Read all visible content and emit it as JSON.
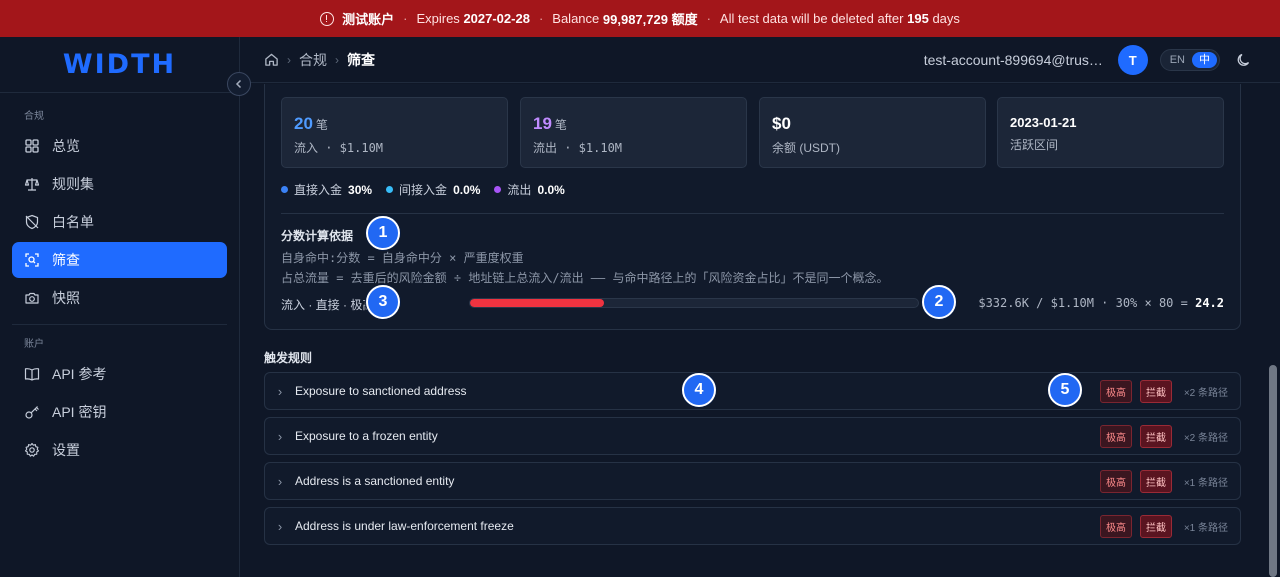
{
  "banner": {
    "account": "测试账户",
    "expires_label": "Expires",
    "expires_value": "2027-02-28",
    "balance_label": "Balance",
    "balance_value": "99,987,729 额度",
    "notice_prefix": "All test data will be deleted after",
    "notice_days": "195",
    "notice_suffix": "days"
  },
  "sidebar": {
    "logo": "WIDTH",
    "section_compliance": "合规",
    "items_compliance": [
      {
        "label": "总览",
        "icon": "grid-icon"
      },
      {
        "label": "规则集",
        "icon": "scale-icon"
      },
      {
        "label": "白名单",
        "icon": "shield-off-icon"
      },
      {
        "label": "筛查",
        "icon": "scan-icon",
        "active": true
      },
      {
        "label": "快照",
        "icon": "camera-icon"
      }
    ],
    "section_account": "账户",
    "items_account": [
      {
        "label": "API 参考",
        "icon": "book-icon"
      },
      {
        "label": "API 密钥",
        "icon": "key-icon"
      },
      {
        "label": "设置",
        "icon": "settings-icon"
      }
    ]
  },
  "header": {
    "breadcrumb": [
      "合规",
      "筛查"
    ],
    "email": "test-account-899694@trustin.info",
    "avatar_initial": "T",
    "lang_en": "EN",
    "lang_zh": "中"
  },
  "stats": [
    {
      "value": "20",
      "unit": "笔",
      "sub": "流入 · $1.10M",
      "color": "#4f9bff"
    },
    {
      "value": "19",
      "unit": "笔",
      "sub": "流出 · $1.10M",
      "color": "#c08bff"
    },
    {
      "value": "$0",
      "unit": "",
      "sub": "余额 (USDT)",
      "color": "#ffffff"
    },
    {
      "value": "2023-01-21",
      "unit": "",
      "sub": "活跃区间",
      "color": "#ffffff"
    }
  ],
  "legend": [
    {
      "label": "直接入金",
      "value": "30%",
      "color": "#3b82f6"
    },
    {
      "label": "间接入金",
      "value": "0.0%",
      "color": "#38bdf8"
    },
    {
      "label": "流出",
      "value": "0.0%",
      "color": "#a855f7"
    }
  ],
  "basis": {
    "title": "分数计算依据",
    "formula1": "自身命中:分数 = 自身命中分 × 严重度权重",
    "formula2": "占总流量 = 去重后的风险金额 ÷ 地址链上总流入/流出 —— 与命中路径上的「风险资金占比」不是同一个概念。",
    "row_label": "流入 · 直接 · 极高",
    "bar_fraction": 0.3,
    "calc_prefix": "$332.6K / $1.10M · 30% × 80 =",
    "calc_result": "24.2"
  },
  "rules": {
    "title": "触发规则",
    "items": [
      {
        "name": "Exposure to sanctioned address",
        "severity": "极高",
        "action": "拦截",
        "paths": "×2 条路径"
      },
      {
        "name": "Exposure to a frozen entity",
        "severity": "极高",
        "action": "拦截",
        "paths": "×2 条路径"
      },
      {
        "name": "Address is a sanctioned entity",
        "severity": "极高",
        "action": "拦截",
        "paths": "×1 条路径"
      },
      {
        "name": "Address is under law-enforcement freeze",
        "severity": "极高",
        "action": "拦截",
        "paths": "×1 条路径"
      }
    ]
  },
  "markers": [
    "1",
    "2",
    "3",
    "4",
    "5"
  ]
}
